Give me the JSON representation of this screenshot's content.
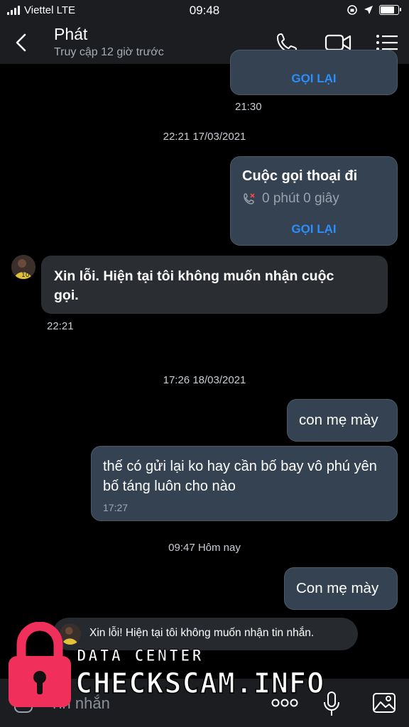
{
  "status": {
    "carrier": "Viettel LTE",
    "time": "09:48",
    "battery_level": 0.85
  },
  "header": {
    "name": "Phát",
    "subtitle": "Truy cập 12 giờ trước"
  },
  "messages": {
    "recall_label": "GỌI LẠI",
    "first_call_time": "21:30",
    "sep1": "22:21 17/03/2021",
    "call2_title": "Cuộc gọi thoại đi",
    "call2_duration": "0 phút 0 giây",
    "in1_text": "Xin lỗi. Hiện tại tôi không muốn nhận cuộc gọi.",
    "in1_time": "22:21",
    "sep2": "17:26 18/03/2021",
    "out1": "con mẹ mày",
    "out2": "thế có gửi lại ko hay cần bố bay vô phú yên bố táng luôn cho nào",
    "out2_time": "17:27",
    "sep3": "09:47 Hôm nay",
    "out3": "Con mẹ mày"
  },
  "notice": {
    "text": "Xin lỗi! Hiện tại tôi không muốn nhận tin nhắn."
  },
  "input": {
    "placeholder": "Tin nhắn"
  },
  "watermark": {
    "line1": "DATA CENTER",
    "line2": "CHECKSCAM.INFO",
    "color": "#f0305a"
  },
  "colors": {
    "accent": "#2d8dfb",
    "bubble_out": "#354251",
    "bubble_in": "#2a2d31"
  },
  "icons": [
    "back-icon",
    "phone-icon",
    "video-icon",
    "menu-icon",
    "missed-call-icon",
    "more-icon",
    "mic-icon",
    "image-icon",
    "lock-icon"
  ]
}
